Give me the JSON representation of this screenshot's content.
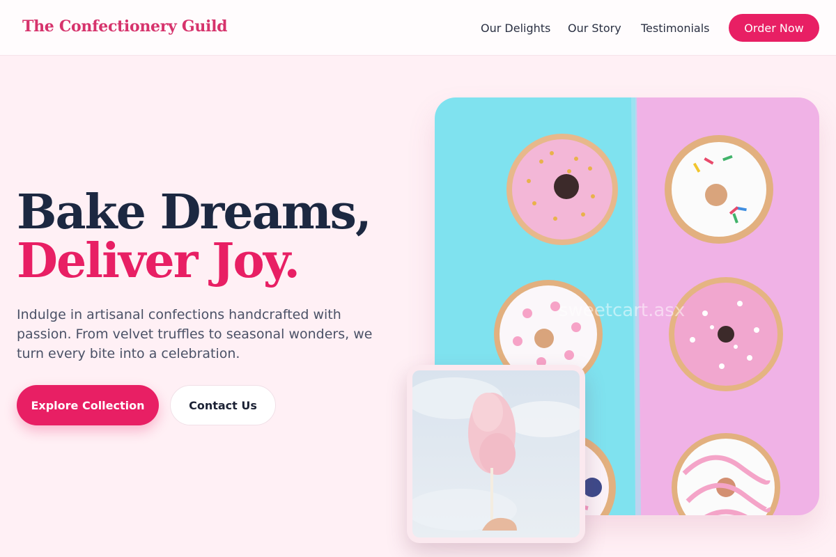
{
  "header": {
    "brand": "The Confectionery Guild",
    "nav": [
      "Our Delights",
      "Our Story",
      "Testimonials"
    ],
    "cta": "Order Now"
  },
  "hero": {
    "title_line1": "Bake Dreams,",
    "title_line2": "Deliver Joy.",
    "description": "Indulge in artisanal confections handcrafted with passion. From velvet truffles to seasonal wonders, we turn every bite into a celebration.",
    "primary_button": "Explore Collection",
    "secondary_button": "Contact Us"
  },
  "images": {
    "main_watermark": "sweetcart.asx"
  },
  "colors": {
    "accent": "#e81f64",
    "brand": "#d6336c",
    "heading": "#1c2841",
    "background": "#fff0f5"
  }
}
